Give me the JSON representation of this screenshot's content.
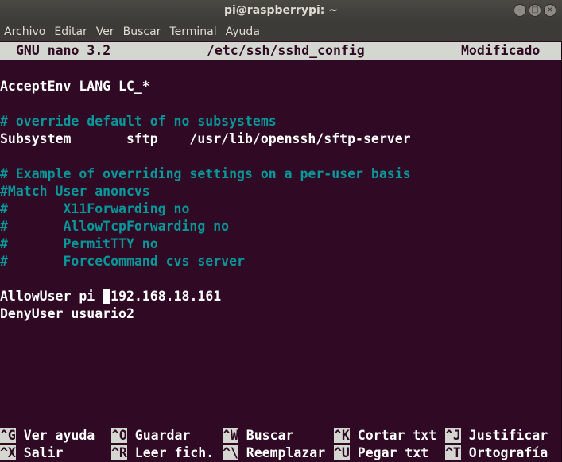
{
  "window": {
    "title": "pi@raspberrypi: ~",
    "buttons": [
      "minimize",
      "maximize",
      "close"
    ]
  },
  "menu": [
    "Archivo",
    "Editar",
    "Ver",
    "Buscar",
    "Terminal",
    "Ayuda"
  ],
  "nano": {
    "version": "GNU nano 3.2",
    "filename": "/etc/ssh/sshd_config",
    "status": "Modificado"
  },
  "editor": {
    "lines": [
      "",
      "AcceptEnv LANG LC_*",
      "",
      "# override default of no subsystems",
      "Subsystem       sftp    /usr/lib/openssh/sftp-server",
      "",
      "# Example of overriding settings on a per-user basis",
      "#Match User anoncvs",
      "#       X11Forwarding no",
      "#       AllowTcpForwarding no",
      "#       PermitTTY no",
      "#       ForceCommand cvs server",
      "",
      "AllowUser pi ",
      "DenyUser usuario2"
    ],
    "cursor_line_rest": "192.168.18.161"
  },
  "shortcuts": {
    "row1": [
      {
        "key": "^G",
        "label": " Ver ayuda"
      },
      {
        "key": "^O",
        "label": " Guardar"
      },
      {
        "key": "^W",
        "label": " Buscar"
      },
      {
        "key": "^K",
        "label": " Cortar txt"
      },
      {
        "key": "^J",
        "label": " Justificar"
      }
    ],
    "row2": [
      {
        "key": "^X",
        "label": " Salir"
      },
      {
        "key": "^R",
        "label": " Leer fich."
      },
      {
        "key": "^\\",
        "label": " Reemplazar"
      },
      {
        "key": "^U",
        "label": " Pegar txt"
      },
      {
        "key": "^T",
        "label": " Ortografía"
      }
    ]
  },
  "colors": {
    "background": "#300a24",
    "comment": "#06989a",
    "header_bg": "#d3d7cf",
    "text": "#ffffff"
  }
}
